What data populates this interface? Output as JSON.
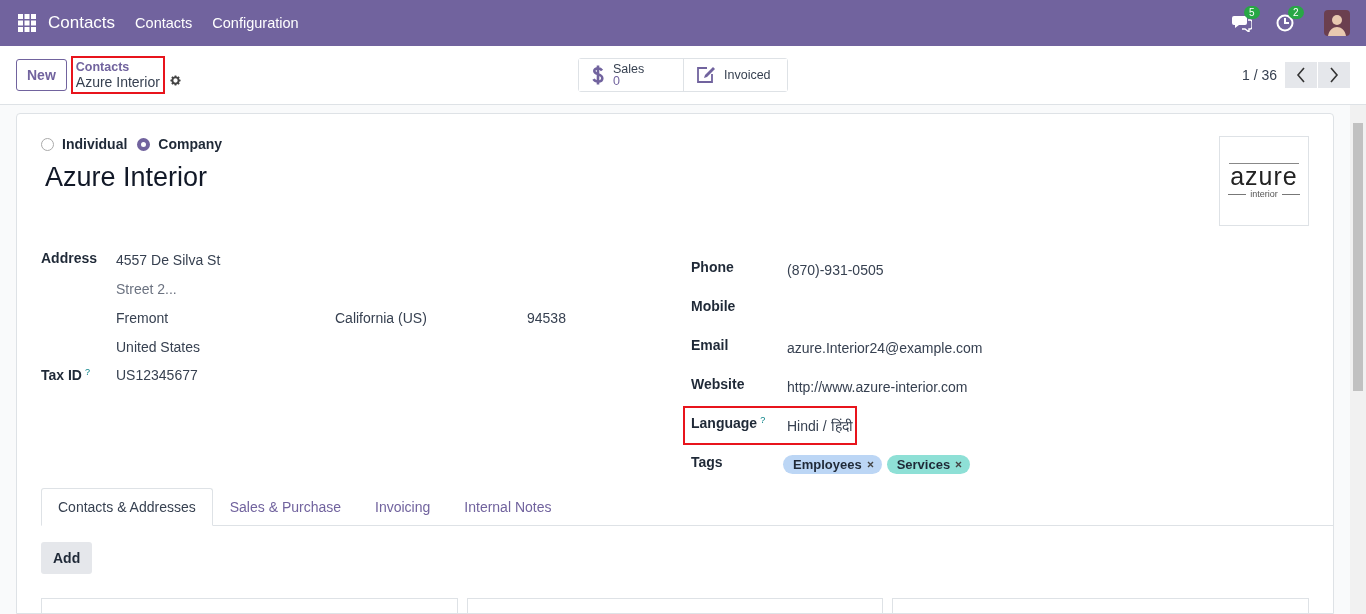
{
  "navbar": {
    "app_title": "Contacts",
    "menu": [
      "Contacts",
      "Configuration"
    ],
    "messages_badge": "5",
    "activities_badge": "2"
  },
  "control_panel": {
    "new_button": "New",
    "breadcrumb": {
      "parent": "Contacts",
      "current": "Azure Interior",
      "highlighted": true
    },
    "smart_buttons": [
      {
        "kind": "stat",
        "label": "Sales",
        "value": "0"
      },
      {
        "kind": "plain",
        "label": "Invoiced"
      }
    ],
    "pager": "1 / 36"
  },
  "form": {
    "company_type": [
      {
        "label": "Individual",
        "selected": false
      },
      {
        "label": "Company",
        "selected": true
      }
    ],
    "name": "Azure Interior",
    "logo": {
      "word": "azure",
      "subword": "interior"
    },
    "address": {
      "label": "Address",
      "street": "4557 De Silva St",
      "street2_placeholder": "Street 2...",
      "city": "Fremont",
      "state": "California (US)",
      "zip": "94538",
      "country": "United States"
    },
    "tax_id": {
      "label": "Tax ID",
      "help": "?",
      "value": "US12345677"
    },
    "right_fields": [
      {
        "label": "Phone",
        "value": "(870)-931-0505",
        "highlighted": false
      },
      {
        "label": "Mobile",
        "highlighted": false
      },
      {
        "label": "Email",
        "value": "azure.Interior24@example.com",
        "highlighted": false
      },
      {
        "label": "Website",
        "value": "http://www.azure-interior.com",
        "highlighted": false
      },
      {
        "label": "Language",
        "help": "?",
        "value": "Hindi / हिंदी",
        "highlighted": true
      }
    ],
    "tags": {
      "label": "Tags",
      "items": [
        {
          "label": "Employees",
          "color": "#bcd6f5"
        },
        {
          "label": "Services",
          "color": "#8ee0d6"
        }
      ]
    },
    "tabs": [
      {
        "label": "Contacts & Addresses",
        "selected": true
      },
      {
        "label": "Sales & Purchase",
        "selected": false
      },
      {
        "label": "Invoicing",
        "selected": false
      },
      {
        "label": "Internal Notes",
        "selected": false
      }
    ],
    "add_button": "Add"
  }
}
